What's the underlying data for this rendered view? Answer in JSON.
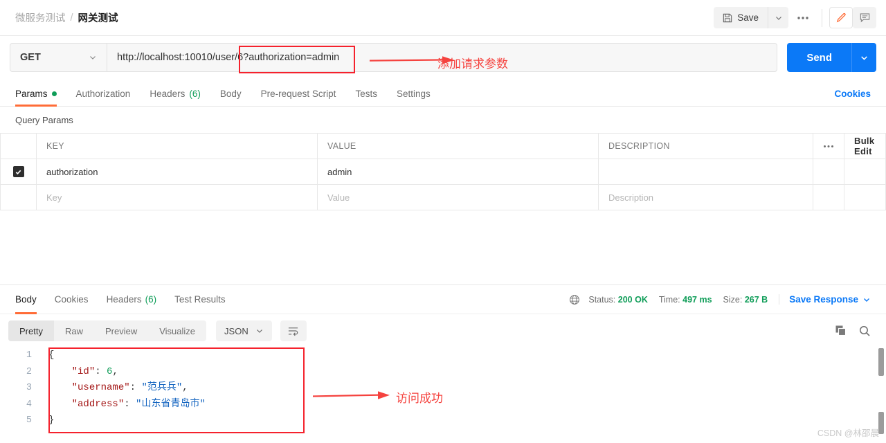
{
  "header": {
    "breadcrumb_parent": "微服务测试",
    "breadcrumb_separator": "/",
    "breadcrumb_current": "网关测试",
    "save_label": "Save",
    "more_label": "000"
  },
  "request": {
    "method": "GET",
    "url": "http://localhost:10010/user/6?authorization=admin",
    "url_base": "http://localhost:10010/user/6",
    "url_query": "?authorization=admin",
    "send_label": "Send"
  },
  "request_tabs": {
    "items": [
      {
        "label": "Params",
        "dot": true,
        "active": true
      },
      {
        "label": "Authorization",
        "dot": false,
        "active": false
      },
      {
        "label": "Headers",
        "count": "(6)",
        "dot": false,
        "active": false
      },
      {
        "label": "Body",
        "dot": false,
        "active": false
      },
      {
        "label": "Pre-request Script",
        "dot": false,
        "active": false
      },
      {
        "label": "Tests",
        "dot": false,
        "active": false
      },
      {
        "label": "Settings",
        "dot": false,
        "active": false
      }
    ],
    "cookies_link": "Cookies"
  },
  "query_params": {
    "title": "Query Params",
    "columns": {
      "key": "KEY",
      "value": "VALUE",
      "description": "DESCRIPTION"
    },
    "dots": "000",
    "bulk_edit": "Bulk Edit",
    "rows": [
      {
        "checked": true,
        "key": "authorization",
        "value": "admin",
        "description": ""
      }
    ],
    "placeholders": {
      "key": "Key",
      "value": "Value",
      "description": "Description"
    }
  },
  "response": {
    "tabs": [
      {
        "label": "Body",
        "active": true
      },
      {
        "label": "Cookies",
        "active": false
      },
      {
        "label": "Headers",
        "count": "(6)",
        "active": false
      },
      {
        "label": "Test Results",
        "active": false
      }
    ],
    "status_label": "Status:",
    "status_value": "200 OK",
    "time_label": "Time:",
    "time_value": "497 ms",
    "size_label": "Size:",
    "size_value": "267 B",
    "save_response": "Save Response",
    "view_modes": [
      {
        "label": "Pretty",
        "active": true
      },
      {
        "label": "Raw",
        "active": false
      },
      {
        "label": "Preview",
        "active": false
      },
      {
        "label": "Visualize",
        "active": false
      }
    ],
    "format": "JSON",
    "line_numbers": [
      "1",
      "2",
      "3",
      "4",
      "5"
    ],
    "body_lines": [
      {
        "text": "{",
        "kind": "punc"
      },
      {
        "key": "\"id\"",
        "sep": ": ",
        "val": "6",
        "val_kind": "num",
        "tail": ","
      },
      {
        "key": "\"username\"",
        "sep": ": ",
        "val": "\"范兵兵\"",
        "val_kind": "str",
        "tail": ","
      },
      {
        "key": "\"address\"",
        "sep": ": ",
        "val": "\"山东省青岛市\"",
        "val_kind": "str",
        "tail": ""
      },
      {
        "text": "}",
        "kind": "punc"
      }
    ]
  },
  "annotations": {
    "url_note": "添加请求参数",
    "body_note": "访问成功"
  },
  "watermark": "CSDN @林邵晨",
  "colors": {
    "accent_orange": "#ff6c37",
    "primary_blue": "#0b79f7",
    "success_green": "#0f9d58",
    "annotation_red": "#f5222d"
  }
}
